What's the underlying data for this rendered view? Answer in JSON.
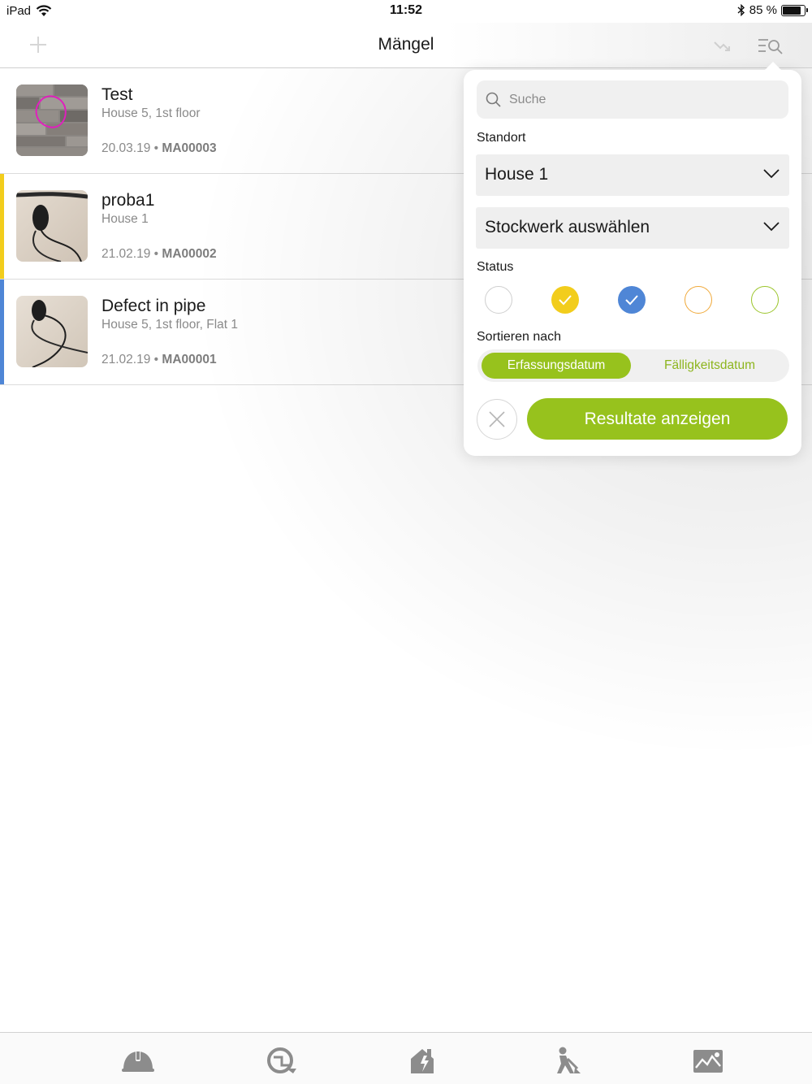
{
  "status_bar": {
    "device": "iPad",
    "time": "11:52",
    "battery_text": "85 %",
    "battery_level": 0.85
  },
  "nav": {
    "title": "Mängel",
    "icons": [
      "plus-icon",
      "sort-icon",
      "filter-search-icon"
    ]
  },
  "list": [
    {
      "title": "Test",
      "subtitle": "House 5, 1st floor",
      "date": "20.03.19",
      "sep": "•",
      "id": "MA00003",
      "stripe": "#ffffff",
      "thumb": "tiles"
    },
    {
      "title": "proba1",
      "subtitle": "House 1",
      "date": "21.02.19",
      "sep": "•",
      "id": "MA00002",
      "stripe": "#f2cd1c",
      "thumb": "cable"
    },
    {
      "title": "Defect in pipe",
      "subtitle": "House 5, 1st floor, Flat 1",
      "date": "21.02.19",
      "sep": "•",
      "id": "MA00001",
      "stripe": "#4f86d6",
      "thumb": "cable"
    }
  ],
  "filter": {
    "search_placeholder": "Suche",
    "location_label": "Standort",
    "location_value": "House 1",
    "floor_value": "Stockwerk auswählen",
    "status_label": "Status",
    "status_options": [
      {
        "color": "#cfcfcf",
        "selected": false,
        "fill": false
      },
      {
        "color": "#f2cd1c",
        "selected": true,
        "fill": true
      },
      {
        "color": "#4f86d6",
        "selected": true,
        "fill": true
      },
      {
        "color": "#f0a93a",
        "selected": false,
        "fill": false
      },
      {
        "color": "#9bc52a",
        "selected": false,
        "fill": false
      }
    ],
    "sort_label": "Sortieren nach",
    "sort_options": [
      "Erfassungsdatum",
      "Fälligkeitsdatum"
    ],
    "sort_selected": "Erfassungsdatum",
    "apply_label": "Resultate anzeigen"
  },
  "tabs": [
    "helmet-icon",
    "plan-icon",
    "building-icon",
    "worker-icon",
    "photos-icon"
  ],
  "colors": {
    "accent": "#97c21d",
    "gray_icon": "#8c8c8c"
  }
}
